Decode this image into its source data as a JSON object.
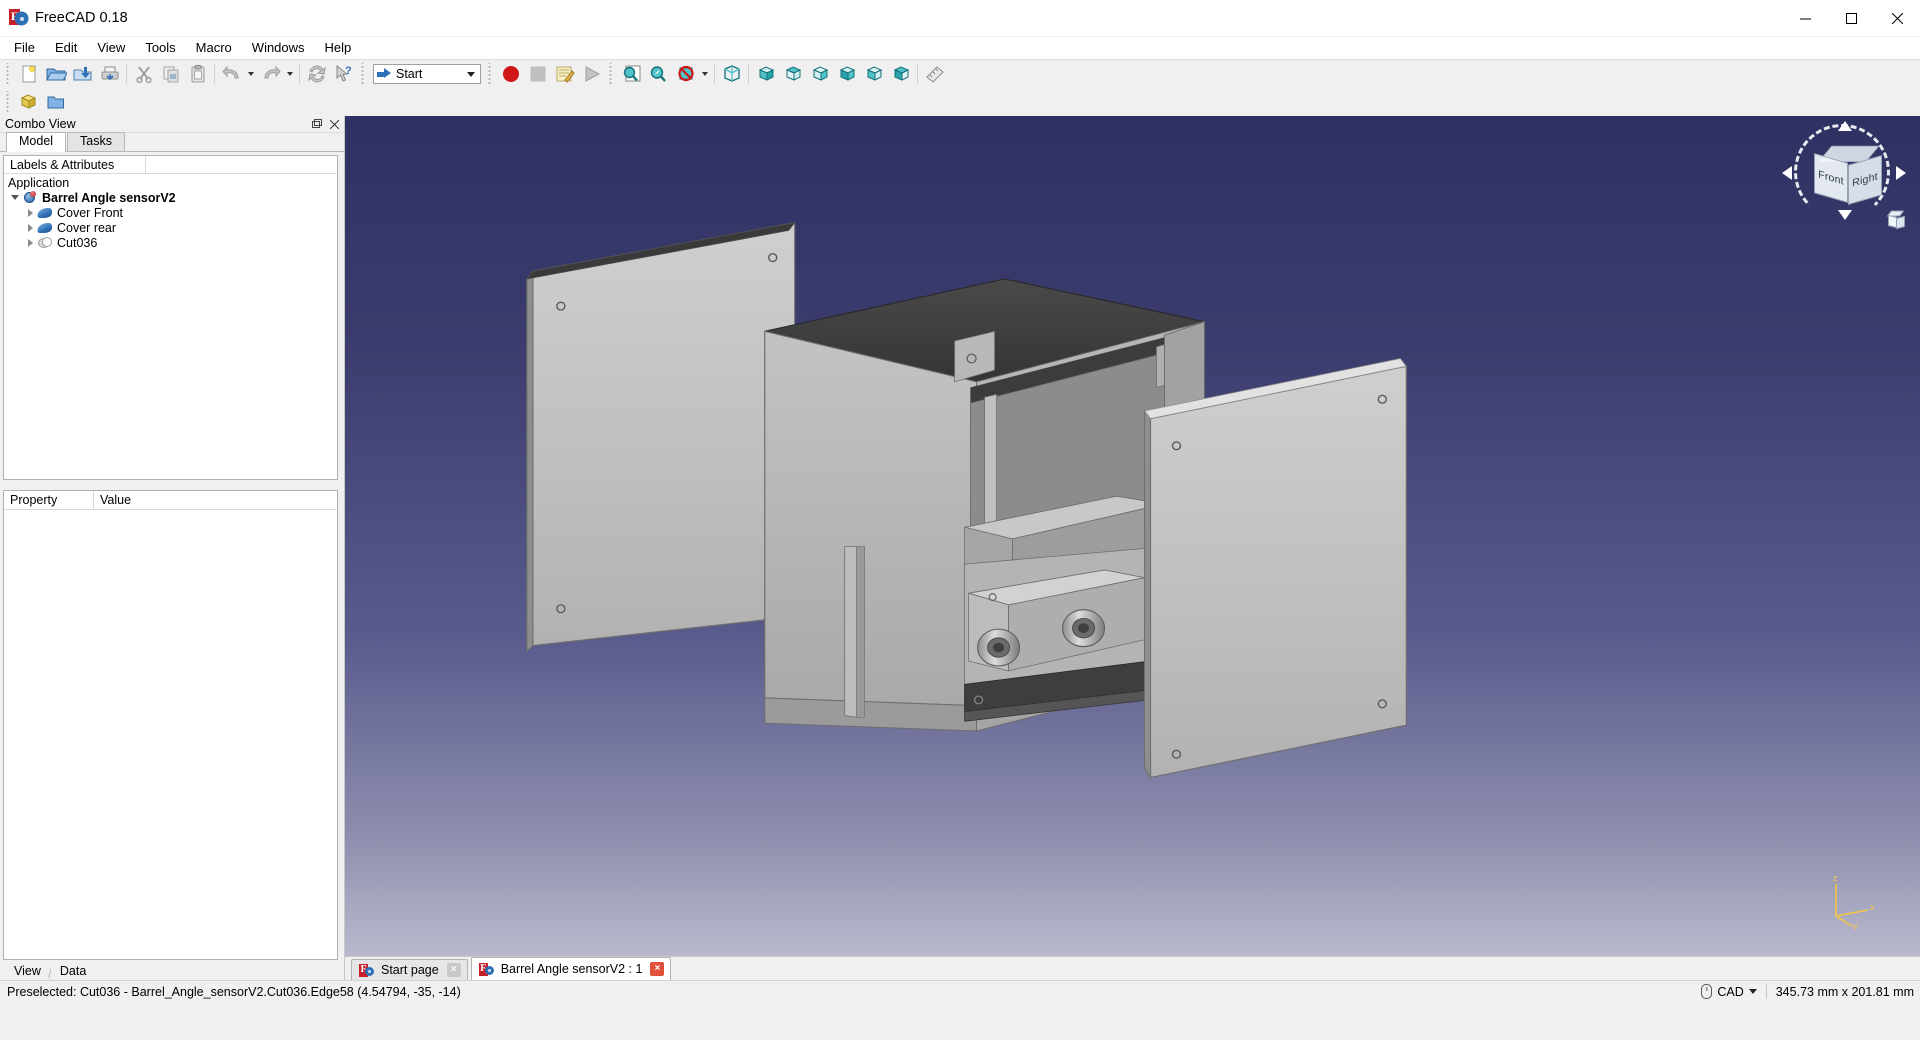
{
  "window": {
    "title": "FreeCAD 0.18",
    "app_icon": "freecad-icon",
    "minimize": "minimize-button",
    "maximize": "maximize-button",
    "close": "close-button"
  },
  "menubar": {
    "items": [
      {
        "label": "File"
      },
      {
        "label": "Edit"
      },
      {
        "label": "View"
      },
      {
        "label": "Tools"
      },
      {
        "label": "Macro"
      },
      {
        "label": "Windows"
      },
      {
        "label": "Help"
      }
    ]
  },
  "toolbars": {
    "file": [
      {
        "name": "new-document-icon",
        "title": "New"
      },
      {
        "name": "open-document-icon",
        "title": "Open"
      },
      {
        "name": "save-document-icon",
        "title": "Save"
      },
      {
        "name": "print-document-icon",
        "title": "Print"
      }
    ],
    "edit": [
      {
        "name": "cut-icon",
        "title": "Cut"
      },
      {
        "name": "copy-icon",
        "title": "Copy"
      },
      {
        "name": "paste-icon",
        "title": "Paste"
      },
      {
        "name": "undo-icon",
        "title": "Undo"
      },
      {
        "name": "redo-icon",
        "title": "Redo"
      },
      {
        "name": "refresh-icon",
        "title": "Refresh"
      },
      {
        "name": "whats-this-icon",
        "title": "What's This?"
      }
    ],
    "workbench": {
      "label": "Start",
      "name": "workbench-selector"
    },
    "macro": [
      {
        "name": "macro-record-icon",
        "title": "Macro recording"
      },
      {
        "name": "macro-stop-icon",
        "title": "Stop macro recording"
      },
      {
        "name": "macros-icon",
        "title": "Macros"
      },
      {
        "name": "macro-execute-icon",
        "title": "Execute macro"
      }
    ],
    "view": [
      {
        "name": "fit-all-icon",
        "title": "Fit all"
      },
      {
        "name": "fit-selection-icon",
        "title": "Fit selection"
      },
      {
        "name": "draw-style-icon",
        "title": "Draw style"
      },
      {
        "name": "axonometric-view-icon",
        "title": "Axonometric"
      },
      {
        "name": "front-view-icon",
        "title": "Front"
      },
      {
        "name": "top-view-icon",
        "title": "Top"
      },
      {
        "name": "right-view-icon",
        "title": "Right"
      },
      {
        "name": "rear-view-icon",
        "title": "Rear"
      },
      {
        "name": "bottom-view-icon",
        "title": "Bottom"
      },
      {
        "name": "left-view-icon",
        "title": "Left"
      },
      {
        "name": "measure-icon",
        "title": "Measure"
      }
    ],
    "second_row": [
      {
        "name": "create-part-icon",
        "title": "Create part"
      },
      {
        "name": "create-group-icon",
        "title": "Create group"
      }
    ]
  },
  "combo_view": {
    "title": "Combo View",
    "float_button": "undock-button",
    "close_button": "close-panel-button",
    "tabs": [
      {
        "label": "Model",
        "active": true
      },
      {
        "label": "Tasks",
        "active": false
      }
    ]
  },
  "tree": {
    "columns": [
      "Labels & Attributes",
      ""
    ],
    "root_label": "Application",
    "items": [
      {
        "label": "Barrel Angle sensorV2",
        "icon": "document-icon",
        "depth": 1,
        "expanded": true,
        "bold": true
      },
      {
        "label": "Cover Front",
        "icon": "part-feature-icon",
        "depth": 2,
        "expanded": false,
        "bold": false
      },
      {
        "label": "Cover rear",
        "icon": "part-feature-icon",
        "depth": 2,
        "expanded": false,
        "bold": false
      },
      {
        "label": "Cut036",
        "icon": "boolean-cut-icon",
        "depth": 2,
        "expanded": false,
        "bold": false
      }
    ]
  },
  "property_editor": {
    "columns": [
      "Property",
      "Value"
    ],
    "rows": []
  },
  "view_data_tabs": [
    {
      "label": "View",
      "active": false
    },
    {
      "label": "Data",
      "active": true
    }
  ],
  "viewport": {
    "background_top": "#2f3163",
    "background_bottom": "#b9b9cd",
    "navigation_cube": {
      "front_label": "Front",
      "right_label": "Right",
      "top_label": ""
    },
    "axis_labels": {
      "z": "z",
      "x": "x",
      "y": "y"
    },
    "axis_color": "#f4c542"
  },
  "document_tabs": [
    {
      "label": "Start page",
      "active": false,
      "close": "close-tab-button"
    },
    {
      "label": "Barrel Angle sensorV2 : 1",
      "active": true,
      "close": "close-tab-button"
    }
  ],
  "statusbar": {
    "message": "Preselected: Cut036 - Barrel_Angle_sensorV2.Cut036.Edge58 (4.54794, -35, -14)",
    "navigation_mode": "CAD",
    "dimensions": "345.73 mm x 201.81 mm"
  }
}
